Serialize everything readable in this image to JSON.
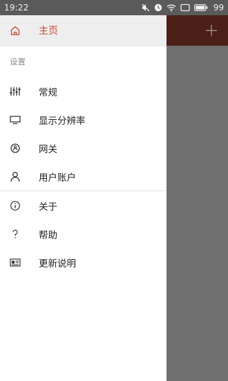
{
  "status_bar": {
    "time": "19:22",
    "battery_level": "99",
    "icons": [
      "mute-icon",
      "alarm-icon",
      "wifi-icon",
      "screen-icon",
      "battery-icon"
    ]
  },
  "app_behind": {
    "toolbar_color": "#4b1f17",
    "add_icon": "plus-icon"
  },
  "drawer": {
    "home": {
      "label": "主页",
      "icon": "home-icon",
      "color": "#c8452e"
    },
    "settings_header": "设置",
    "settings_items": [
      {
        "label": "常规",
        "icon": "sliders-icon"
      },
      {
        "label": "显示分辨率",
        "icon": "monitor-icon"
      },
      {
        "label": "网关",
        "icon": "router-icon"
      },
      {
        "label": "用户账户",
        "icon": "user-icon"
      }
    ],
    "other_items": [
      {
        "label": "关于",
        "icon": "info-icon"
      },
      {
        "label": "帮助",
        "icon": "help-icon"
      },
      {
        "label": "更新说明",
        "icon": "news-icon"
      }
    ]
  }
}
